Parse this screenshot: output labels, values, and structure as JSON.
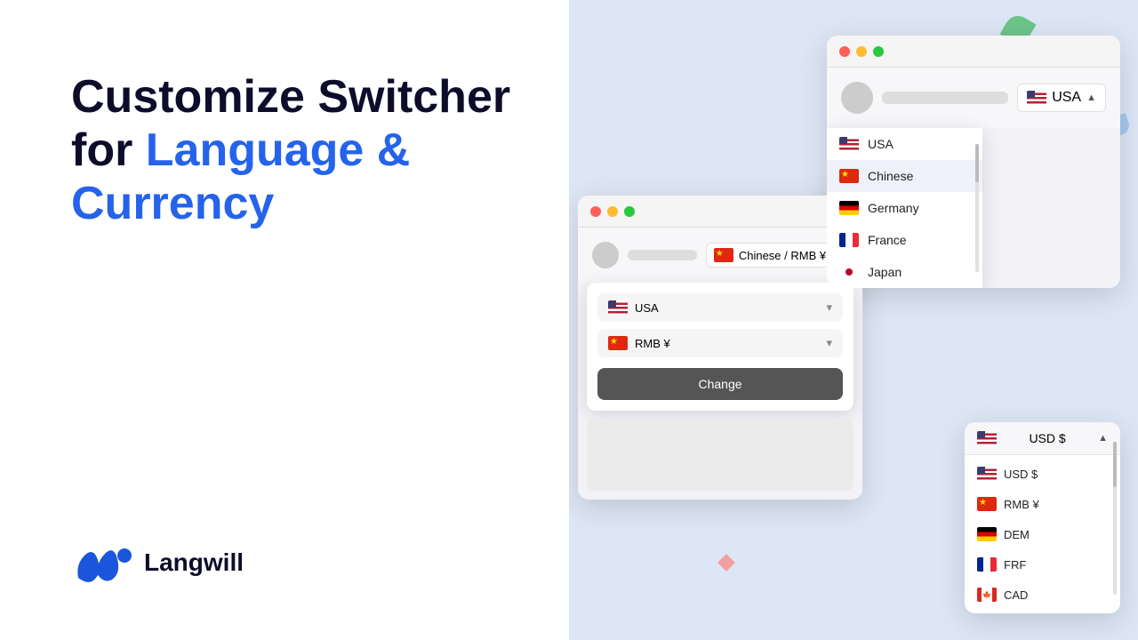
{
  "left": {
    "headline_line1": "Customize Switcher",
    "headline_line2": "for ",
    "headline_blue": "Language &",
    "headline_line3": "Currency",
    "logo_text": "Langwill"
  },
  "right": {
    "win1": {
      "current_lang": "USA",
      "items": [
        {
          "label": "USA",
          "flag": "us"
        },
        {
          "label": "Chinese",
          "flag": "cn",
          "active": true
        },
        {
          "label": "Germany",
          "flag": "de"
        },
        {
          "label": "France",
          "flag": "fr"
        },
        {
          "label": "Japan",
          "flag": "jp"
        }
      ]
    },
    "win2": {
      "current_label": "Chinese / RMB ¥",
      "lang_select": "USA",
      "curr_select": "RMB ¥",
      "change_btn": "Change"
    },
    "win3": {
      "current": "USD $",
      "items": [
        {
          "label": "USD $",
          "flag": "us"
        },
        {
          "label": "RMB ¥",
          "flag": "cn"
        },
        {
          "label": "DEM",
          "flag": "de"
        },
        {
          "label": "FRF",
          "flag": "fr"
        },
        {
          "label": "CAD",
          "flag": "ca"
        }
      ]
    }
  }
}
